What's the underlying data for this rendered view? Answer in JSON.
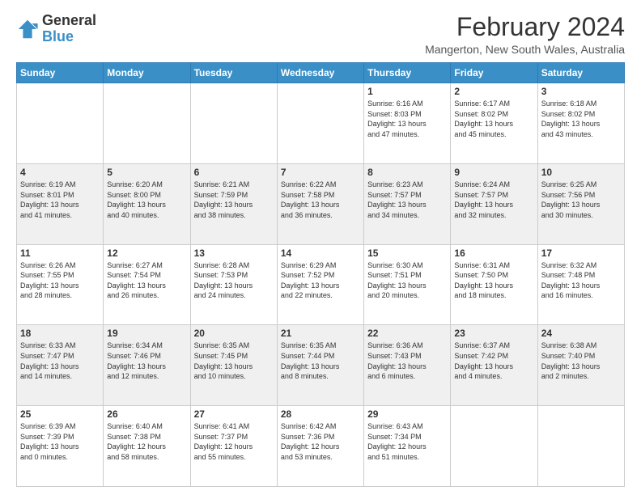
{
  "logo": {
    "line1": "General",
    "line2": "Blue"
  },
  "header": {
    "title": "February 2024",
    "subtitle": "Mangerton, New South Wales, Australia"
  },
  "days": [
    "Sunday",
    "Monday",
    "Tuesday",
    "Wednesday",
    "Thursday",
    "Friday",
    "Saturday"
  ],
  "weeks": [
    [
      {
        "day": "",
        "info": ""
      },
      {
        "day": "",
        "info": ""
      },
      {
        "day": "",
        "info": ""
      },
      {
        "day": "",
        "info": ""
      },
      {
        "day": "1",
        "info": "Sunrise: 6:16 AM\nSunset: 8:03 PM\nDaylight: 13 hours\nand 47 minutes."
      },
      {
        "day": "2",
        "info": "Sunrise: 6:17 AM\nSunset: 8:02 PM\nDaylight: 13 hours\nand 45 minutes."
      },
      {
        "day": "3",
        "info": "Sunrise: 6:18 AM\nSunset: 8:02 PM\nDaylight: 13 hours\nand 43 minutes."
      }
    ],
    [
      {
        "day": "4",
        "info": "Sunrise: 6:19 AM\nSunset: 8:01 PM\nDaylight: 13 hours\nand 41 minutes."
      },
      {
        "day": "5",
        "info": "Sunrise: 6:20 AM\nSunset: 8:00 PM\nDaylight: 13 hours\nand 40 minutes."
      },
      {
        "day": "6",
        "info": "Sunrise: 6:21 AM\nSunset: 7:59 PM\nDaylight: 13 hours\nand 38 minutes."
      },
      {
        "day": "7",
        "info": "Sunrise: 6:22 AM\nSunset: 7:58 PM\nDaylight: 13 hours\nand 36 minutes."
      },
      {
        "day": "8",
        "info": "Sunrise: 6:23 AM\nSunset: 7:57 PM\nDaylight: 13 hours\nand 34 minutes."
      },
      {
        "day": "9",
        "info": "Sunrise: 6:24 AM\nSunset: 7:57 PM\nDaylight: 13 hours\nand 32 minutes."
      },
      {
        "day": "10",
        "info": "Sunrise: 6:25 AM\nSunset: 7:56 PM\nDaylight: 13 hours\nand 30 minutes."
      }
    ],
    [
      {
        "day": "11",
        "info": "Sunrise: 6:26 AM\nSunset: 7:55 PM\nDaylight: 13 hours\nand 28 minutes."
      },
      {
        "day": "12",
        "info": "Sunrise: 6:27 AM\nSunset: 7:54 PM\nDaylight: 13 hours\nand 26 minutes."
      },
      {
        "day": "13",
        "info": "Sunrise: 6:28 AM\nSunset: 7:53 PM\nDaylight: 13 hours\nand 24 minutes."
      },
      {
        "day": "14",
        "info": "Sunrise: 6:29 AM\nSunset: 7:52 PM\nDaylight: 13 hours\nand 22 minutes."
      },
      {
        "day": "15",
        "info": "Sunrise: 6:30 AM\nSunset: 7:51 PM\nDaylight: 13 hours\nand 20 minutes."
      },
      {
        "day": "16",
        "info": "Sunrise: 6:31 AM\nSunset: 7:50 PM\nDaylight: 13 hours\nand 18 minutes."
      },
      {
        "day": "17",
        "info": "Sunrise: 6:32 AM\nSunset: 7:48 PM\nDaylight: 13 hours\nand 16 minutes."
      }
    ],
    [
      {
        "day": "18",
        "info": "Sunrise: 6:33 AM\nSunset: 7:47 PM\nDaylight: 13 hours\nand 14 minutes."
      },
      {
        "day": "19",
        "info": "Sunrise: 6:34 AM\nSunset: 7:46 PM\nDaylight: 13 hours\nand 12 minutes."
      },
      {
        "day": "20",
        "info": "Sunrise: 6:35 AM\nSunset: 7:45 PM\nDaylight: 13 hours\nand 10 minutes."
      },
      {
        "day": "21",
        "info": "Sunrise: 6:35 AM\nSunset: 7:44 PM\nDaylight: 13 hours\nand 8 minutes."
      },
      {
        "day": "22",
        "info": "Sunrise: 6:36 AM\nSunset: 7:43 PM\nDaylight: 13 hours\nand 6 minutes."
      },
      {
        "day": "23",
        "info": "Sunrise: 6:37 AM\nSunset: 7:42 PM\nDaylight: 13 hours\nand 4 minutes."
      },
      {
        "day": "24",
        "info": "Sunrise: 6:38 AM\nSunset: 7:40 PM\nDaylight: 13 hours\nand 2 minutes."
      }
    ],
    [
      {
        "day": "25",
        "info": "Sunrise: 6:39 AM\nSunset: 7:39 PM\nDaylight: 13 hours\nand 0 minutes."
      },
      {
        "day": "26",
        "info": "Sunrise: 6:40 AM\nSunset: 7:38 PM\nDaylight: 12 hours\nand 58 minutes."
      },
      {
        "day": "27",
        "info": "Sunrise: 6:41 AM\nSunset: 7:37 PM\nDaylight: 12 hours\nand 55 minutes."
      },
      {
        "day": "28",
        "info": "Sunrise: 6:42 AM\nSunset: 7:36 PM\nDaylight: 12 hours\nand 53 minutes."
      },
      {
        "day": "29",
        "info": "Sunrise: 6:43 AM\nSunset: 7:34 PM\nDaylight: 12 hours\nand 51 minutes."
      },
      {
        "day": "",
        "info": ""
      },
      {
        "day": "",
        "info": ""
      }
    ]
  ]
}
